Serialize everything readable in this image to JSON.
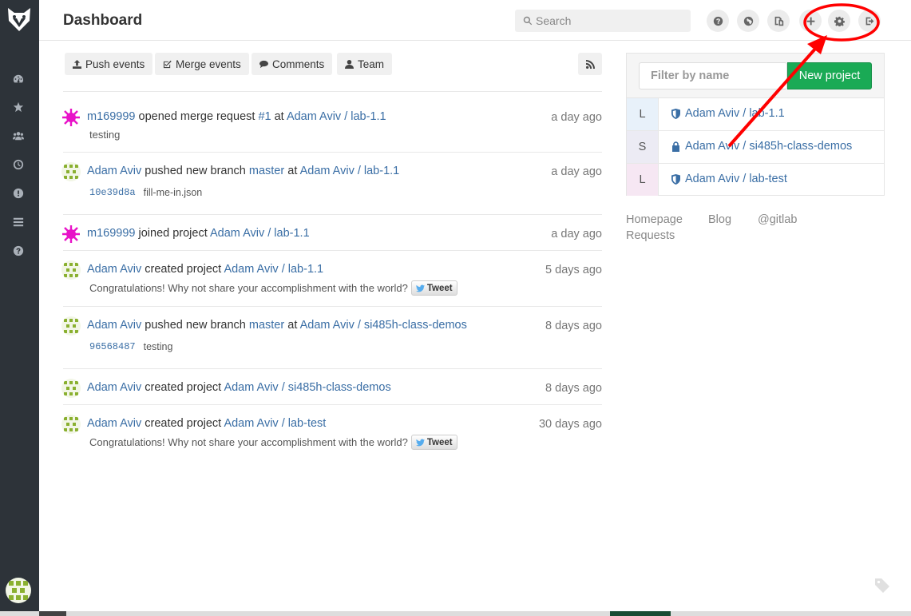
{
  "sidebar": {
    "logo_icon": "gitlab-fox-logo",
    "items": [
      {
        "icon": "dashboard-icon"
      },
      {
        "icon": "star-icon"
      },
      {
        "icon": "groups-icon"
      },
      {
        "icon": "clock-icon"
      },
      {
        "icon": "issues-icon"
      },
      {
        "icon": "list-icon"
      },
      {
        "icon": "help-icon"
      }
    ]
  },
  "header": {
    "title": "Dashboard",
    "search_placeholder": "Search",
    "buttons": [
      "help-icon",
      "globe-icon",
      "copy-icon",
      "plus-icon",
      "gear-icon",
      "sign-out-icon"
    ]
  },
  "filters": {
    "push": "Push events",
    "merge": "Merge events",
    "comments": "Comments",
    "team": "Team",
    "rss_icon": "rss-icon"
  },
  "events": [
    {
      "author": "m169999",
      "action": "opened merge request",
      "ref": "#1",
      "prep": "at",
      "project": "Adam Aviv / lab-1.1",
      "time": "a day ago",
      "note": "testing"
    },
    {
      "author": "Adam Aviv",
      "action": "pushed new branch",
      "ref": "master",
      "prep": "at",
      "project": "Adam Aviv / lab-1.1",
      "time": "a day ago",
      "sha": "10e39d8a",
      "message": "fill-me-in.json"
    },
    {
      "author": "m169999",
      "action": "joined project",
      "project": "Adam Aviv / lab-1.1",
      "time": "a day ago"
    },
    {
      "author": "Adam Aviv",
      "action": "created project",
      "project": "Adam Aviv / lab-1.1",
      "time": "5 days ago",
      "congrats": "Congratulations! Why not share your accomplishment with the world?",
      "tweet": "Tweet"
    },
    {
      "author": "Adam Aviv",
      "action": "pushed new branch",
      "ref": "master",
      "prep": "at",
      "project": "Adam Aviv / si485h-class-demos",
      "time": "8 days ago",
      "sha": "96568487",
      "message": "testing"
    },
    {
      "author": "Adam Aviv",
      "action": "created project",
      "project": "Adam Aviv / si485h-class-demos",
      "time": "8 days ago"
    },
    {
      "author": "Adam Aviv",
      "action": "created project",
      "project": "Adam Aviv / lab-test",
      "time": "30 days ago",
      "congrats": "Congratulations! Why not share your accomplishment with the world?",
      "tweet": "Tweet"
    }
  ],
  "projects_panel": {
    "filter_placeholder": "Filter by name",
    "new_project": "New project",
    "items": [
      {
        "letter": "L",
        "name": "Adam Aviv / lab-1.1",
        "visibility": "shield-icon",
        "letter_bg": "#e8f1fa"
      },
      {
        "letter": "S",
        "name": "Adam Aviv / si485h-class-demos",
        "visibility": "lock-icon",
        "letter_bg": "#ecebf4"
      },
      {
        "letter": "L",
        "name": "Adam Aviv / lab-test",
        "visibility": "shield-icon",
        "letter_bg": "#f6e7f3"
      }
    ]
  },
  "footer": {
    "homepage": "Homepage",
    "blog": "Blog",
    "gitlab": "@gitlab",
    "requests": "Requests"
  },
  "colors": {
    "sidebar_bg": "#2d3339",
    "link": "#3a6ea5",
    "new_project_btn": "#1aaa55",
    "annotation": "#ff0000"
  }
}
